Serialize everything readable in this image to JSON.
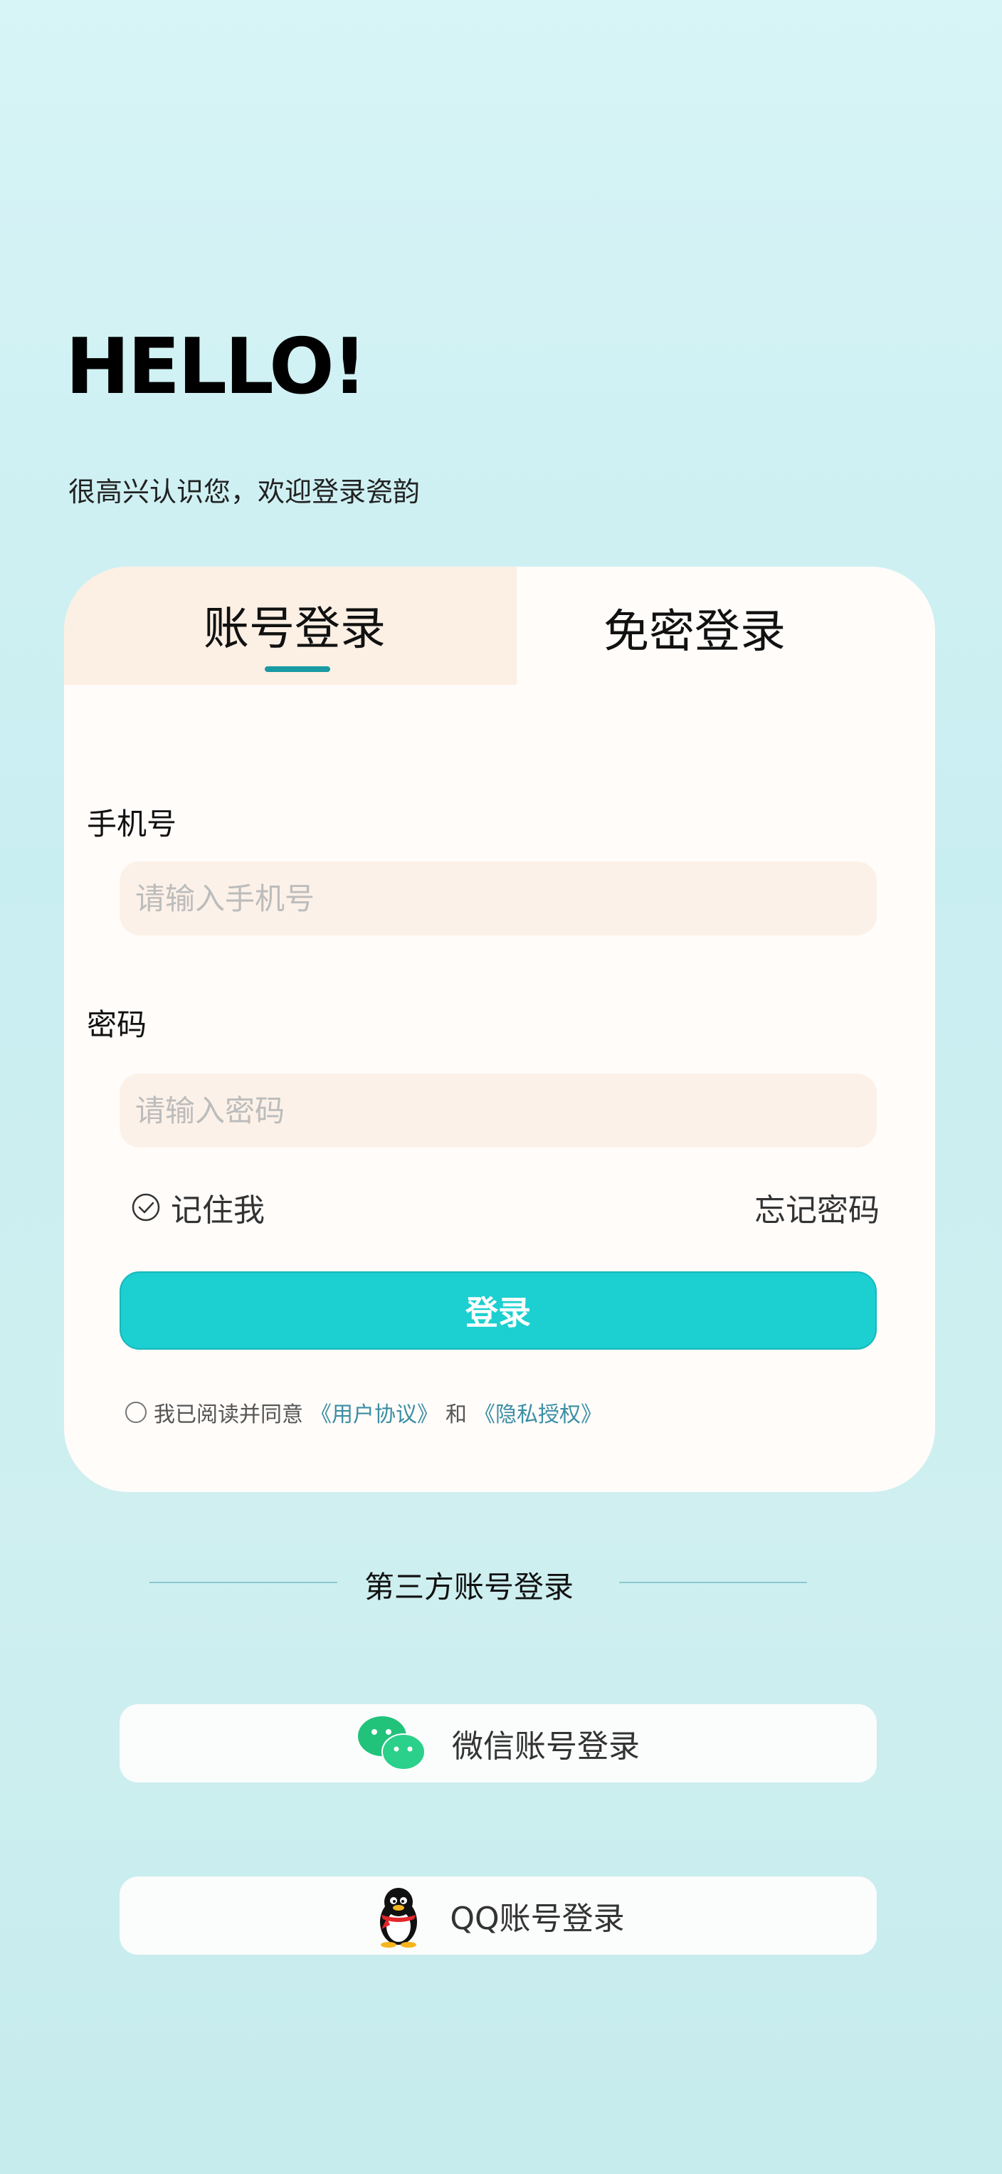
{
  "greeting": {
    "title": "HELLO!",
    "subtitle": "很高兴认识您，欢迎登录瓷韵"
  },
  "tabs": {
    "account": "账号登录",
    "passwordless": "免密登录"
  },
  "form": {
    "phone_label": "手机号",
    "phone_placeholder": "请输入手机号",
    "password_label": "密码",
    "password_placeholder": "请输入密码",
    "remember_me": "记住我",
    "forgot_password": "忘记密码",
    "login_button": "登录"
  },
  "agreement": {
    "prefix": "我已阅读并同意",
    "user_agreement": "《用户协议》",
    "and": "和",
    "privacy": "《隐私授权》"
  },
  "third_party": {
    "title": "第三方账号登录",
    "wechat": "微信账号登录",
    "qq": "QQ账号登录"
  },
  "colors": {
    "accent": "#1ccfd0",
    "tab_indicator": "#1a9aa3",
    "link": "#3b8ea4"
  }
}
